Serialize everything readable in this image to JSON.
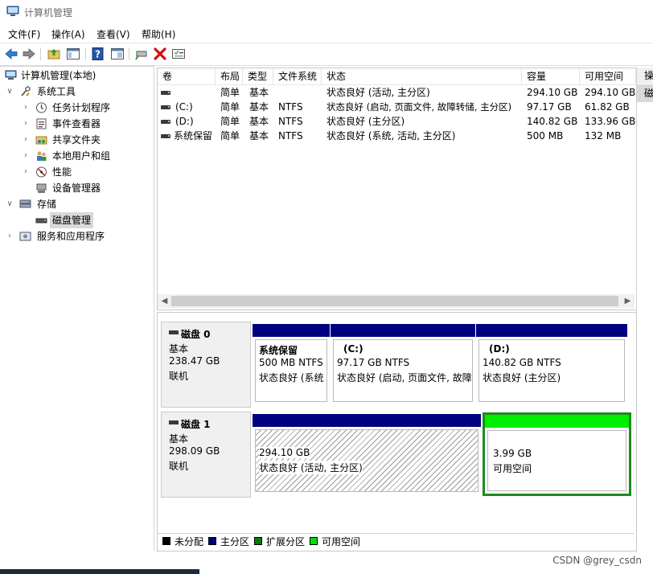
{
  "window": {
    "title": "计算机管理"
  },
  "menu": [
    "文件(F)",
    "操作(A)",
    "查看(V)",
    "帮助(H)"
  ],
  "toolbar": {
    "icons": [
      "back-arrow-icon",
      "forward-arrow-icon",
      "up-folder-icon",
      "show-hide-tree-icon",
      "help-icon",
      "properties-icon",
      "connect-icon",
      "delete-icon",
      "checklist-icon"
    ],
    "delete_color": "#d10f0f"
  },
  "tree": {
    "root": "计算机管理(本地)",
    "system_tools": "系统工具",
    "task_scheduler": "任务计划程序",
    "event_viewer": "事件查看器",
    "shared_folders": "共享文件夹",
    "local_users": "本地用户和组",
    "performance": "性能",
    "device_manager": "设备管理器",
    "storage": "存储",
    "disk_management": "磁盘管理",
    "services": "服务和应用程序"
  },
  "volume_table": {
    "headers": [
      "卷",
      "布局",
      "类型",
      "文件系统",
      "状态",
      "容量",
      "可用空间"
    ],
    "rows": [
      {
        "volume": "",
        "layout": "简单",
        "type": "基本",
        "fs": "",
        "status": "状态良好 (活动, 主分区)",
        "capacity": "294.10 GB",
        "free": "294.10 GB"
      },
      {
        "volume": "(C:)",
        "layout": "简单",
        "type": "基本",
        "fs": "NTFS",
        "status": "状态良好 (启动, 页面文件, 故障转储, 主分区)",
        "capacity": "97.17 GB",
        "free": "61.82 GB"
      },
      {
        "volume": "(D:)",
        "layout": "简单",
        "type": "基本",
        "fs": "NTFS",
        "status": "状态良好 (主分区)",
        "capacity": "140.82 GB",
        "free": "133.96 GB"
      },
      {
        "volume": "系统保留",
        "layout": "简单",
        "type": "基本",
        "fs": "NTFS",
        "status": "状态良好 (系统, 活动, 主分区)",
        "capacity": "500 MB",
        "free": "132 MB"
      }
    ]
  },
  "actions": {
    "header": "操",
    "item": "磁"
  },
  "disks": [
    {
      "name": "磁盘 0",
      "type": "基本",
      "size": "238.47 GB",
      "state": "联机",
      "partitions": [
        {
          "name": "系统保留",
          "size": "500 MB NTFS",
          "status": "状态良好 (系统"
        },
        {
          "name": "(C:)",
          "size": "97.17 GB NTFS",
          "status": "状态良好 (启动, 页面文件, 故障"
        },
        {
          "name": "(D:)",
          "size": "140.82 GB NTFS",
          "status": "状态良好 (主分区)"
        }
      ]
    },
    {
      "name": "磁盘 1",
      "type": "基本",
      "size": "298.09 GB",
      "state": "联机",
      "partitions": [
        {
          "size": "294.10 GB",
          "status": "状态良好 (活动, 主分区)"
        },
        {
          "size": "3.99 GB",
          "status": "可用空间"
        }
      ]
    }
  ],
  "legend": [
    {
      "label": "未分配",
      "color": "#000000"
    },
    {
      "label": "主分区",
      "color": "#000080"
    },
    {
      "label": "扩展分区",
      "color": "#008000"
    },
    {
      "label": "可用空间",
      "color": "#00e000"
    }
  ],
  "colors": {
    "primary_bar": "#000080",
    "free_bar": "#00ee00",
    "free_border": "#1e8a1e",
    "selection": "#d9d9d9"
  },
  "watermark": "CSDN @grey_csdn"
}
